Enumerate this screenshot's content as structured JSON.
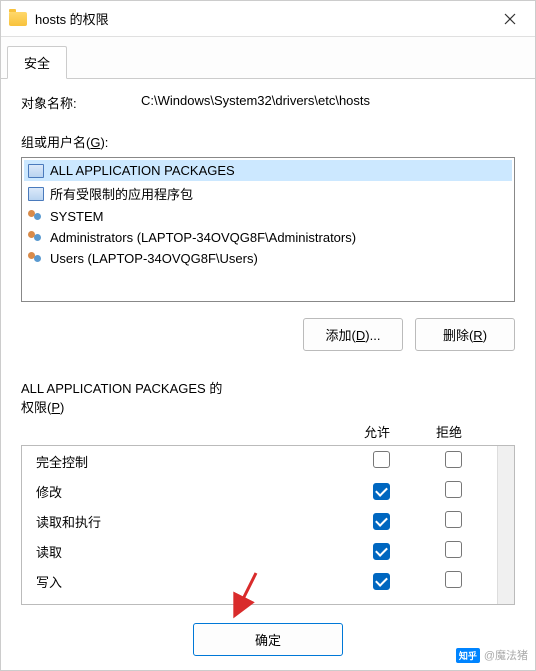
{
  "titlebar": {
    "title": "hosts 的权限"
  },
  "tab": {
    "label": "安全"
  },
  "object": {
    "label": "对象名称:",
    "value": "C:\\Windows\\System32\\drivers\\etc\\hosts"
  },
  "groups": {
    "label_pre": "组或用户名(",
    "label_u": "G",
    "label_post": "):",
    "items": [
      {
        "icon": "pkg",
        "name": "ALL APPLICATION PACKAGES",
        "selected": true
      },
      {
        "icon": "pkg",
        "name": "所有受限制的应用程序包",
        "selected": false
      },
      {
        "icon": "users",
        "name": "SYSTEM",
        "selected": false
      },
      {
        "icon": "users",
        "name": "Administrators (LAPTOP-34OVQG8F\\Administrators)",
        "selected": false
      },
      {
        "icon": "users",
        "name": "Users (LAPTOP-34OVQG8F\\Users)",
        "selected": false
      }
    ]
  },
  "buttons": {
    "add_pre": "添加(",
    "add_u": "D",
    "add_post": ")...",
    "remove_pre": "删除(",
    "remove_u": "R",
    "remove_post": ")"
  },
  "perms": {
    "header_pre": "ALL APPLICATION PACKAGES 的\n权限(",
    "header_u": "P",
    "header_post": ")",
    "col_allow": "允许",
    "col_deny": "拒绝",
    "rows": [
      {
        "name": "完全控制",
        "allow": false,
        "deny": false
      },
      {
        "name": "修改",
        "allow": true,
        "deny": false
      },
      {
        "name": "读取和执行",
        "allow": true,
        "deny": false
      },
      {
        "name": "读取",
        "allow": true,
        "deny": false
      },
      {
        "name": "写入",
        "allow": true,
        "deny": false
      }
    ]
  },
  "footer": {
    "ok": "确定"
  },
  "watermark": {
    "logo": "知乎",
    "text": "@魔法猪"
  }
}
